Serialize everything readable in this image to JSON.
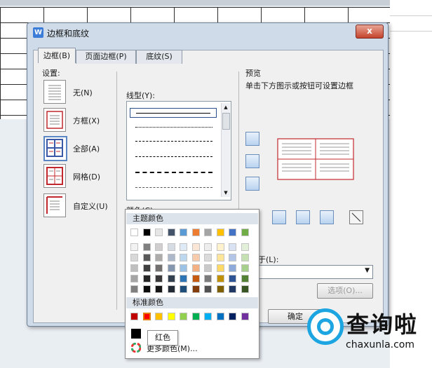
{
  "dialog": {
    "title": "边框和底纹",
    "close_label": "x",
    "tabs": [
      {
        "label": "边框(B)"
      },
      {
        "label": "页面边框(P)"
      },
      {
        "label": "底纹(S)"
      }
    ]
  },
  "settings": {
    "heading": "设置:",
    "items": [
      {
        "label": "无(N)",
        "icon": "setting-none-icon"
      },
      {
        "label": "方框(X)",
        "icon": "setting-box-icon"
      },
      {
        "label": "全部(A)",
        "icon": "setting-all-icon"
      },
      {
        "label": "网格(D)",
        "icon": "setting-grid-icon"
      },
      {
        "label": "自定义(U)",
        "icon": "setting-custom-icon"
      }
    ]
  },
  "line_style": {
    "label": "线型(Y):"
  },
  "color": {
    "label": "颜色(C):",
    "value_hex": "#ff0000"
  },
  "preview": {
    "heading": "预览",
    "hint": "单击下方图示或按钮可设置边框"
  },
  "apply": {
    "label": "于(L):"
  },
  "options_button": "选项(O)...",
  "ok_button": "确定",
  "palette": {
    "theme_title": "主题颜色",
    "standard_title": "标准颜色",
    "theme_row": [
      "#ffffff",
      "#000000",
      "#e7e6e6",
      "#44546a",
      "#5b9bd5",
      "#ed7d31",
      "#a5a5a5",
      "#ffc000",
      "#4472c4",
      "#70ad47"
    ],
    "theme_shades": [
      [
        "#f2f2f2",
        "#7f7f7f",
        "#d0cece",
        "#d6dce4",
        "#deebf6",
        "#fbe5d5",
        "#ededed",
        "#fff2cc",
        "#dae3f3",
        "#e2efd9"
      ],
      [
        "#d8d8d8",
        "#595959",
        "#aeabab",
        "#adb9ca",
        "#bdd7ee",
        "#f7cbac",
        "#dbdbdb",
        "#fee599",
        "#b4c6e7",
        "#c5e0b3"
      ],
      [
        "#bfbfbf",
        "#3f3f3f",
        "#757070",
        "#8496b0",
        "#9cc3e5",
        "#f4b183",
        "#c9c9c9",
        "#ffd965",
        "#8eaadb",
        "#a8d08d"
      ],
      [
        "#a5a5a5",
        "#262626",
        "#3a3838",
        "#323f4f",
        "#2e75b5",
        "#c55a11",
        "#7b7b7b",
        "#bf9000",
        "#2f5496",
        "#538135"
      ],
      [
        "#7f7f7f",
        "#0c0c0c",
        "#171616",
        "#222a35",
        "#1e4e79",
        "#833c0b",
        "#525252",
        "#7f6000",
        "#1f3864",
        "#375623"
      ]
    ],
    "standard_row": [
      "#c00000",
      "#ff0000",
      "#ffc000",
      "#ffff00",
      "#92d050",
      "#00b050",
      "#00b0f0",
      "#0070c0",
      "#002060",
      "#7030a0"
    ],
    "selected_color_hex": "#000000",
    "tooltip": "红色",
    "more_colors": "更多颜色(M)..."
  },
  "watermark": {
    "brand": "查询啦",
    "url": "chaxunla.com"
  }
}
